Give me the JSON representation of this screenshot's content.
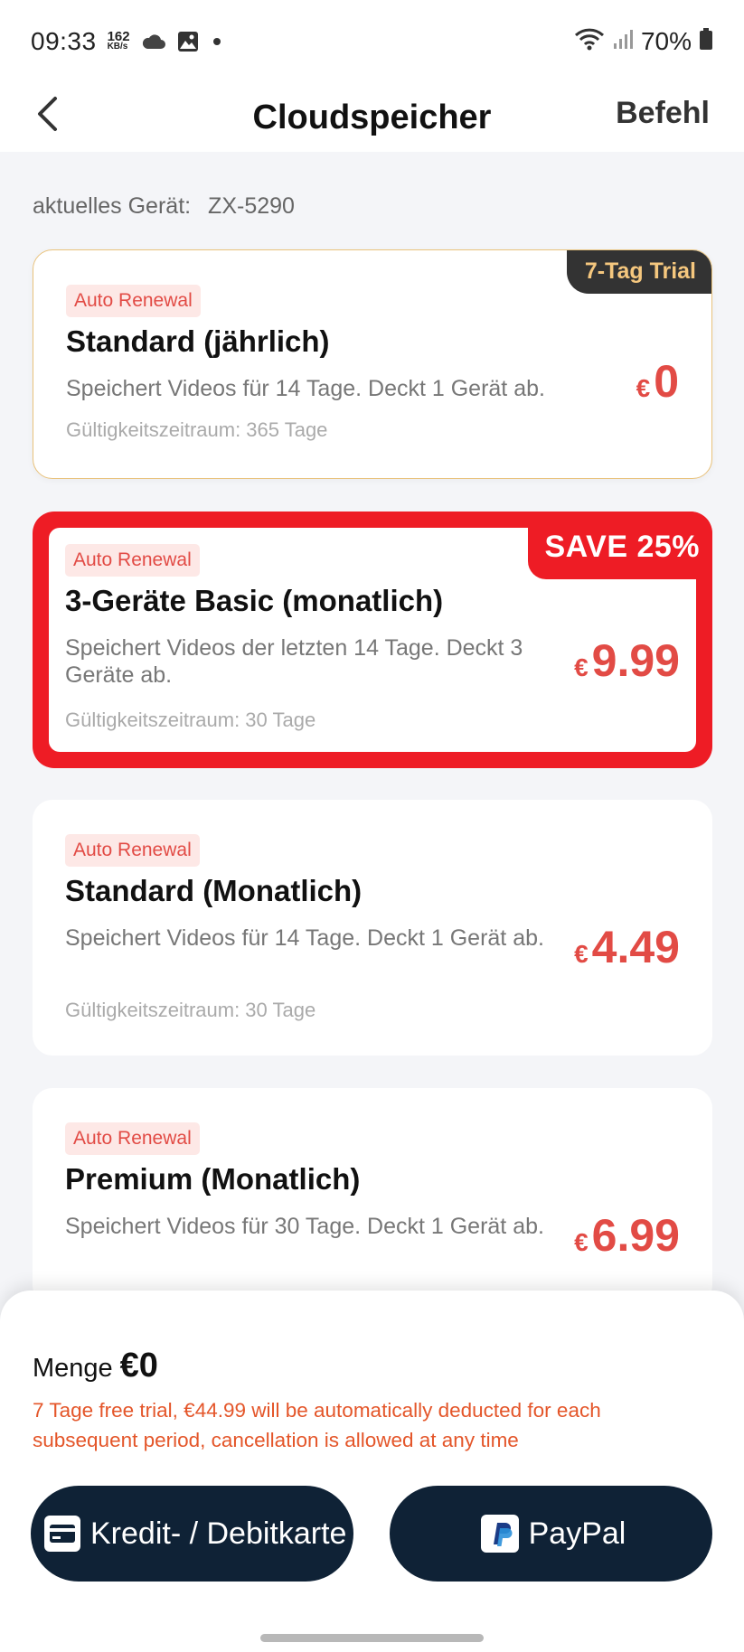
{
  "status_bar": {
    "time": "09:33",
    "net_speed_value": "162",
    "net_speed_unit": "KB/s",
    "battery": "70%"
  },
  "header": {
    "title": "Cloudspeicher",
    "action_label": "Befehl"
  },
  "device": {
    "label": "aktuelles Gerät:",
    "value": "ZX-5290"
  },
  "plans": [
    {
      "tag": "Auto Renewal",
      "name": "Standard (jährlich)",
      "description": "Speichert Videos für 14 Tage. Deckt 1 Gerät ab.",
      "validity": "Gültigkeitszeitraum: 365 Tage",
      "currency": "€",
      "price": "0",
      "badge": "7-Tag Trial"
    },
    {
      "tag": "Auto Renewal",
      "name": "3-Geräte Basic (monatlich)",
      "description": "Speichert Videos der letzten 14 Tage. Deckt 3 Geräte ab.",
      "validity": "Gültigkeitszeitraum: 30 Tage",
      "currency": "€",
      "price": "9.99",
      "badge": "SAVE 25%"
    },
    {
      "tag": "Auto Renewal",
      "name": "Standard (Monatlich)",
      "description": "Speichert Videos für 14 Tage. Deckt 1 Gerät ab.",
      "validity": "Gültigkeitszeitraum: 30 Tage",
      "currency": "€",
      "price": "4.49"
    },
    {
      "tag": "Auto Renewal",
      "name": "Premium (Monatlich)",
      "description": "Speichert Videos für 30 Tage. Deckt 1 Gerät ab.",
      "currency": "€",
      "price": "6.99"
    }
  ],
  "summary": {
    "label": "Menge",
    "amount": "€0",
    "note": "7 Tage free trial, €44.99 will be automatically deducted for each subsequent period, cancellation is allowed at any time"
  },
  "payment": {
    "card_label": "Kredit- / Debitkarte",
    "paypal_label": "PayPal"
  },
  "colors": {
    "accent_red": "#ee1c25",
    "price_red": "#e24b45",
    "button_navy": "#0f2236",
    "trial_gold": "#f5c77e",
    "note_orange": "#e4562a"
  },
  "icons": [
    "back-arrow-icon",
    "cloud-icon",
    "image-icon",
    "wifi-icon",
    "signal-icon",
    "battery-icon",
    "credit-card-icon",
    "paypal-icon"
  ]
}
